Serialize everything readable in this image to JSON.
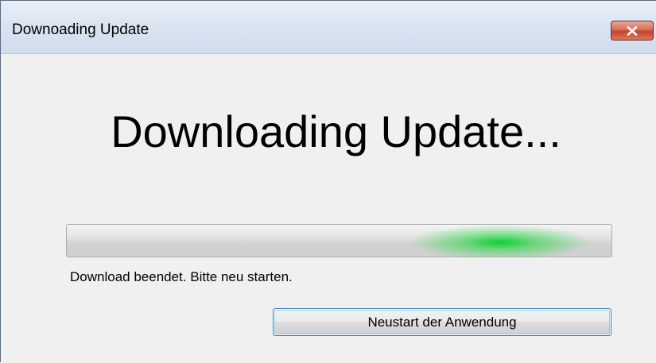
{
  "window": {
    "title": "Downoading Update",
    "close_icon": "close-icon",
    "accent_color": "#c4432b"
  },
  "main": {
    "heading": "Downloading Update...",
    "progress": {
      "style": "marquee",
      "color": "#00d228"
    },
    "status_text": "Download beendet. Bitte neu starten.",
    "restart_button_label": "Neustart der Anwendung"
  }
}
